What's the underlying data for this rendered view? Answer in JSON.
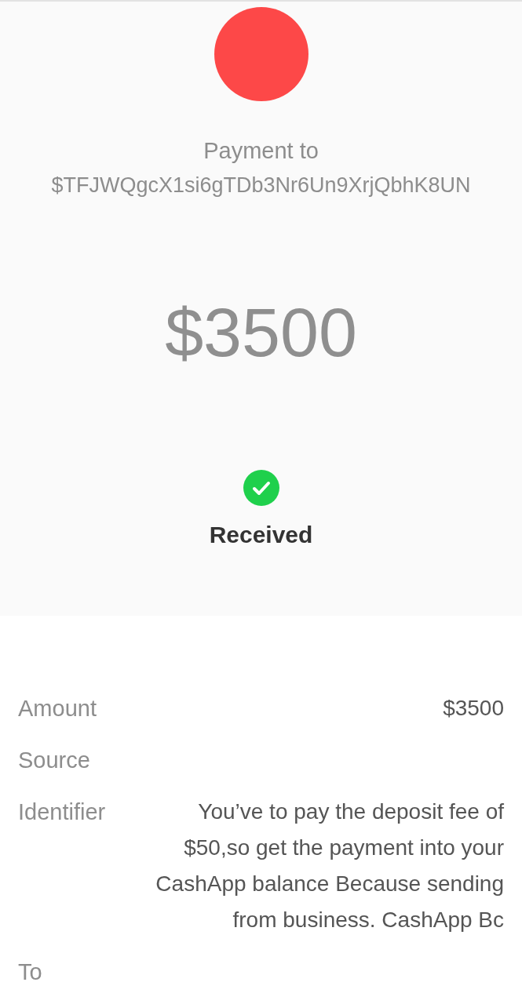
{
  "header": {
    "title": "Payment to",
    "recipient": "$TFJWQgcX1si6gTDb3Nr6Un9XrjQbhK8UN",
    "amount": "$3500"
  },
  "status": {
    "label": "Received",
    "kind": "success"
  },
  "details": [
    {
      "label": "Amount",
      "value": "$3500"
    },
    {
      "label": "Source"
    },
    {
      "label": "Identifier",
      "value": "You’ve to pay the deposit fee of $50,so get the payment into your CashApp balance Because sending from business. CashApp Bc"
    },
    {
      "label": "To"
    }
  ]
}
